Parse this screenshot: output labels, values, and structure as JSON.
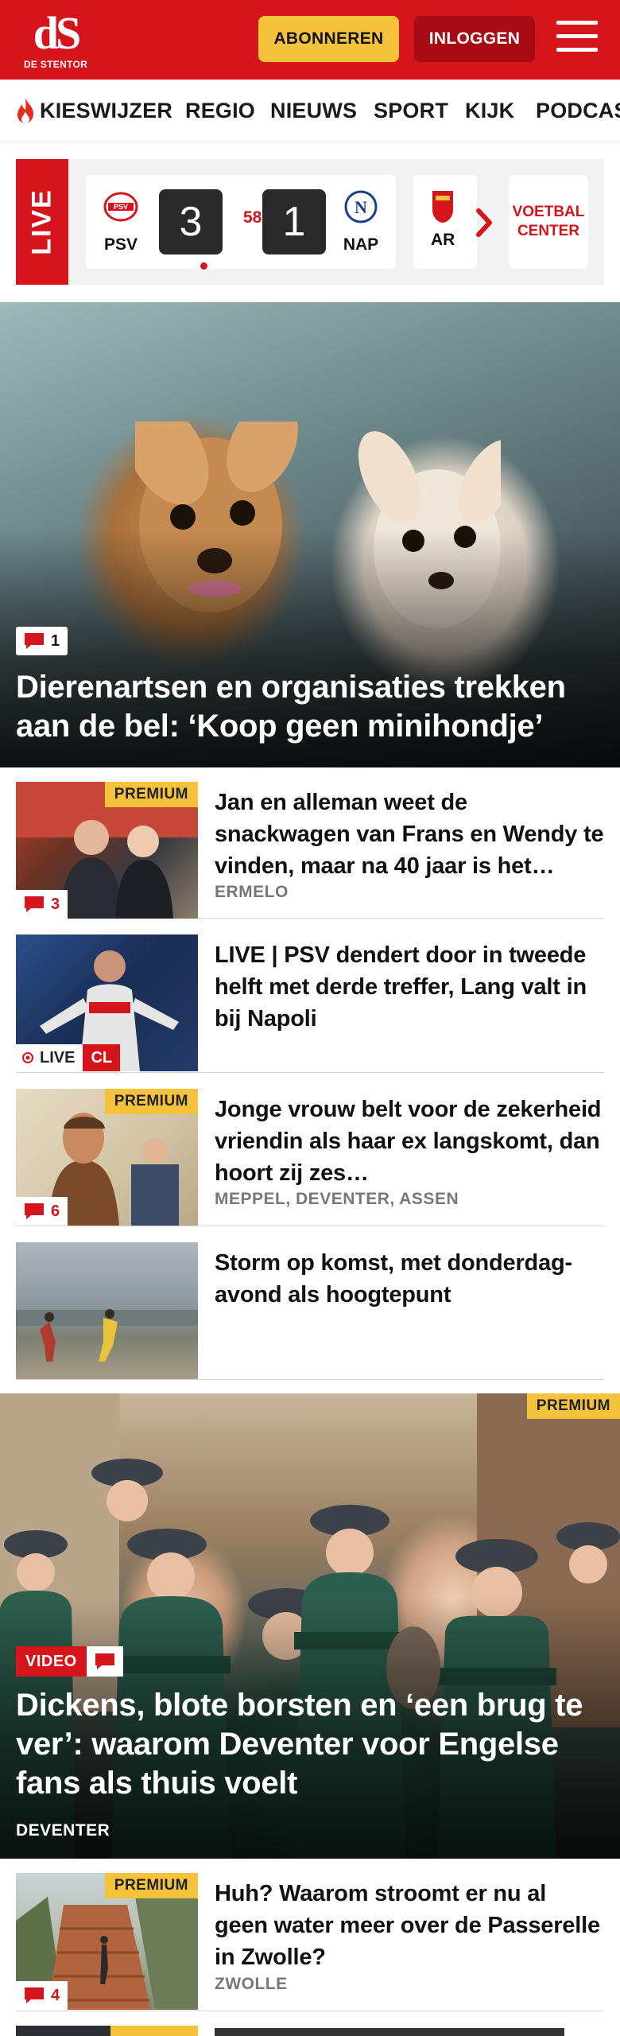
{
  "header": {
    "logo_text": "dS",
    "logo_subtitle": "DE STENTOR",
    "subscribe_label": "ABONNEREN",
    "login_label": "INLOGGEN",
    "brand_color": "#d6141c",
    "subscribe_color": "#f5c33b"
  },
  "nav": {
    "items": [
      {
        "label": "KIESWIJZER",
        "icon": "flame-icon"
      },
      {
        "label": "REGIO"
      },
      {
        "label": "NIEUWS"
      },
      {
        "label": "SPORT"
      },
      {
        "label": "KIJK"
      },
      {
        "label": "PODCAS"
      }
    ]
  },
  "live_scores": {
    "tab_label": "LIVE",
    "match": {
      "home_team": "PSV",
      "home_score": "3",
      "minute": "58'",
      "away_score": "1",
      "away_team": "NAP"
    },
    "next_match_team": "AR",
    "voetbal_center_label": "VOETBAL CENTER"
  },
  "hero": {
    "comments": "1",
    "title": "Dierenartsen en organisaties trekken aan de bel: ‘Koop geen minihondje’"
  },
  "articles": [
    {
      "title": "Jan en alleman weet de snackwagen van Frans en Wendy te vinden, maar na 40 jaar is het…",
      "location": "ERMELO",
      "premium_label": "PREMIUM",
      "comments": "3"
    },
    {
      "title": "LIVE | PSV dendert door in tweede helft met derde treffer, Lang valt in bij Napoli",
      "live_label": "LIVE",
      "competition": "CL"
    },
    {
      "title": "Jonge vrouw belt voor de zekerheid vriendin als haar ex langskomt, dan hoort zij zes…",
      "location": "MEPPEL, DEVENTER, ASSEN",
      "premium_label": "PREMIUM",
      "comments": "6"
    },
    {
      "title": "Storm op komst, met donderdag-avond als hoogtepunt"
    }
  ],
  "feature": {
    "premium_label": "PREMIUM",
    "video_label": "VIDEO",
    "title": "Dickens, blote borsten en ‘een brug te ver’: waarom Deventer voor Engelse fans als thuis voelt",
    "location": "DEVENTER"
  },
  "bottom_article": {
    "title": "Huh? Waarom stroomt er nu al geen water meer over de Passerelle in Zwolle?",
    "location": "ZWOLLE",
    "premium_label": "PREMIUM",
    "comments": "4"
  },
  "partial_article": {
    "premium_label": "PREMIUM"
  }
}
